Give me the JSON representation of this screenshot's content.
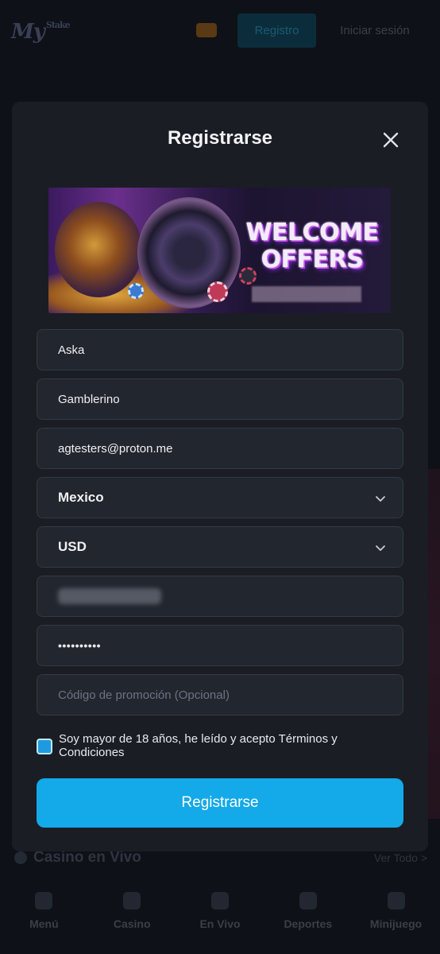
{
  "background": {
    "logo": "My",
    "logo_suffix": "Stake",
    "register_label": "Registro",
    "login_label": "Iniciar sesión",
    "section_title": "Casino en Vivo",
    "section_link": "Ver Todo >",
    "nav": [
      {
        "label": "Menú",
        "icon": "menu-icon"
      },
      {
        "label": "Casino",
        "icon": "casino-icon"
      },
      {
        "label": "En Vivo",
        "icon": "live-icon"
      },
      {
        "label": "Deportes",
        "icon": "sports-icon"
      },
      {
        "label": "Minijuego",
        "icon": "minigame-icon"
      }
    ]
  },
  "modal": {
    "title": "Registrarse",
    "close_icon": "close-icon",
    "banner": {
      "headline_line1": "WELCOME",
      "headline_line2": "OFFERS"
    },
    "fields": {
      "first_name": "Aska",
      "last_name": "Gamblerino",
      "email": "agtesters@proton.me",
      "country": "Mexico",
      "currency": "USD",
      "password": "••••••••••",
      "promo_placeholder": "Código de promoción (Opcional)"
    },
    "terms_text": "Soy mayor de 18 años, he leído y acepto Términos y Condiciones",
    "terms_checked": true,
    "submit_label": "Registrarse",
    "accent_color": "#14a9e8"
  }
}
